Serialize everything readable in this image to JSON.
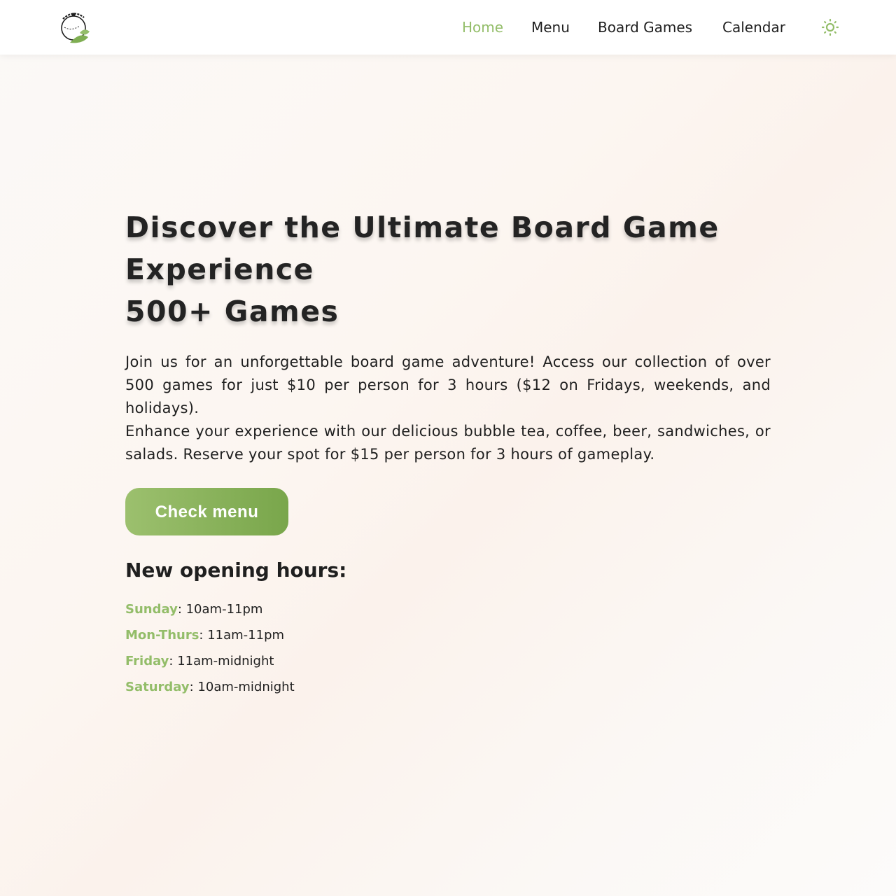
{
  "nav": {
    "logo_alt": "sip & play",
    "links": [
      {
        "label": "Home",
        "active": true
      },
      {
        "label": "Menu",
        "active": false
      },
      {
        "label": "Board Games",
        "active": false
      },
      {
        "label": "Calendar",
        "active": false
      }
    ],
    "theme_icon": "sun-icon"
  },
  "hero": {
    "title_lines": [
      "Discover the Ultimate Board Game",
      "Experience",
      "500+ Games"
    ],
    "paragraphs": [
      "Join us for an unforgettable board game adventure! Access our collection of over 500 games for just $10 per person for 3 hours ($12 on Fridays, weekends, and holidays).",
      "Enhance your experience with our delicious bubble tea, coffee, beer, sandwiches, or salads. Reserve your spot for $15 per person for 3 hours of gameplay."
    ],
    "cta_label": "Check menu"
  },
  "hours": {
    "title": "New opening hours:",
    "items": [
      {
        "day": "Sunday",
        "time": ": 10am-11pm"
      },
      {
        "day": "Mon-Thurs",
        "time": ": 11am-11pm"
      },
      {
        "day": "Friday",
        "time": ": 11am-midnight"
      },
      {
        "day": "Saturday",
        "time": ": 10am-midnight"
      }
    ]
  },
  "colors": {
    "accent": "#93bd69",
    "button_start": "#9cc06e",
    "button_end": "#79a64b",
    "text": "#1f1f1f"
  }
}
